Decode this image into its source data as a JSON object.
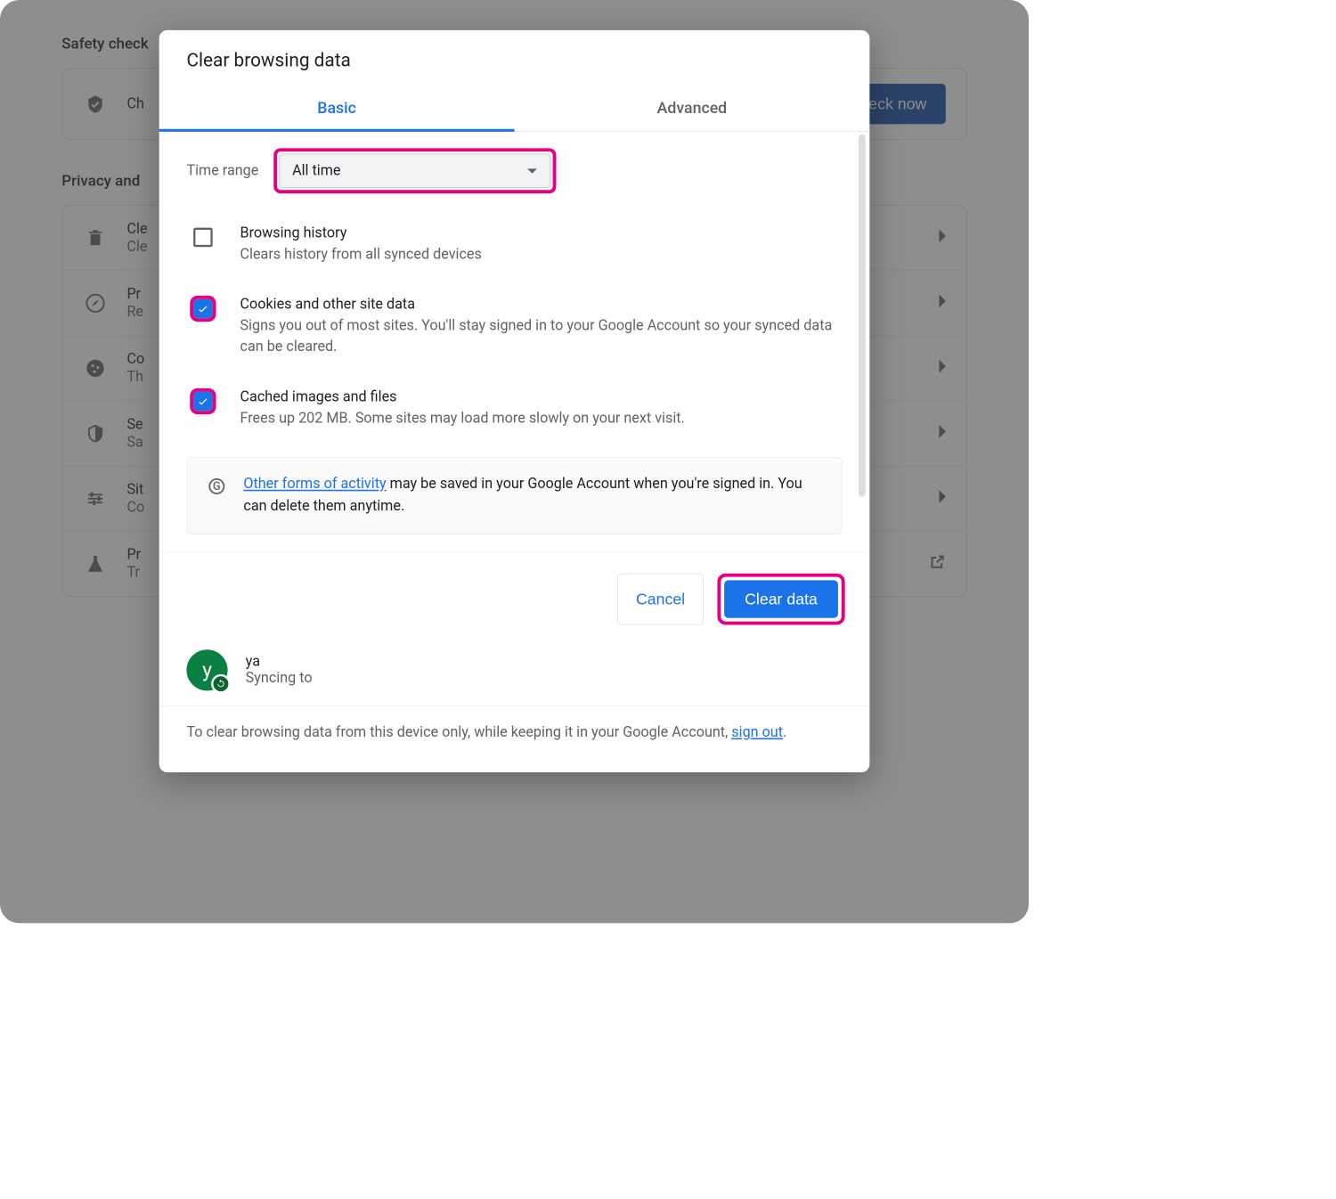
{
  "background": {
    "safety_title": "Safety check",
    "safety_row_label": "Ch",
    "check_now": "Check now",
    "privacy_title": "Privacy and",
    "rows": [
      {
        "icon": "trash",
        "label": "Cle",
        "sub": "Cle"
      },
      {
        "icon": "compass",
        "label": "Pr",
        "sub": "Re"
      },
      {
        "icon": "cookie",
        "label": "Co",
        "sub": "Th"
      },
      {
        "icon": "shield-half",
        "label": "Se",
        "sub": "Sa"
      },
      {
        "icon": "sliders",
        "label": "Sit",
        "sub": "Co"
      },
      {
        "icon": "flask",
        "label": "Pr",
        "sub": "Tr"
      }
    ]
  },
  "modal": {
    "title": "Clear browsing data",
    "tabs": {
      "basic": "Basic",
      "advanced": "Advanced"
    },
    "time_range_label": "Time range",
    "time_range_value": "All time",
    "options": [
      {
        "title": "Browsing history",
        "desc": "Clears history from all synced devices",
        "checked": false,
        "highlight": false
      },
      {
        "title": "Cookies and other site data",
        "desc": "Signs you out of most sites. You'll stay signed in to your Google Account so your synced data can be cleared.",
        "checked": true,
        "highlight": true
      },
      {
        "title": "Cached images and files",
        "desc": "Frees up 202 MB. Some sites may load more slowly on your next visit.",
        "checked": true,
        "highlight": true
      }
    ],
    "info_link": "Other forms of activity",
    "info_text_rest": " may be saved in your Google Account when you're signed in. You can delete them anytime.",
    "cancel": "Cancel",
    "clear": "Clear data",
    "user": {
      "initial": "y",
      "name": "ya",
      "status": "Syncing to"
    },
    "footnote_prefix": "To clear browsing data from this device only, while keeping it in your Google Account, ",
    "footnote_link": "sign out",
    "footnote_suffix": "."
  }
}
